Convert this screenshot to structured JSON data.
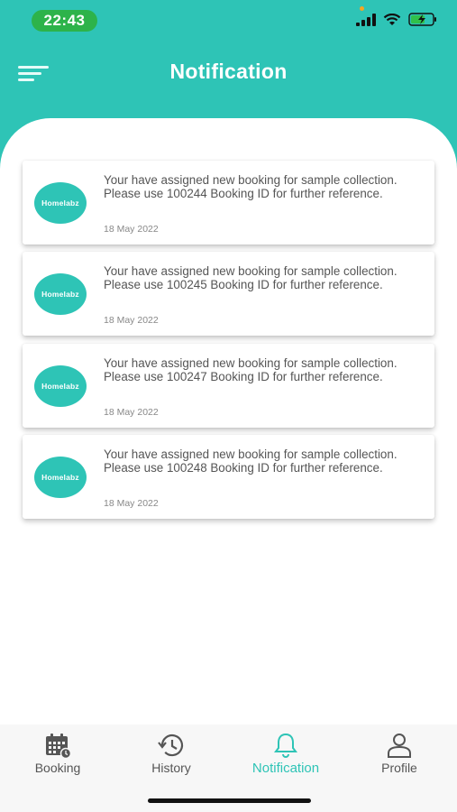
{
  "status_bar": {
    "time": "22:43"
  },
  "header": {
    "title": "Notification"
  },
  "notifications": [
    {
      "logo_text": "Homelabz",
      "message": "Your have assigned new booking for sample collection. Please use 100244 Booking ID for further reference.",
      "date": "18 May 2022"
    },
    {
      "logo_text": "Homelabz",
      "message": "Your have assigned new booking for sample collection. Please use 100245 Booking ID for further reference.",
      "date": "18 May 2022"
    },
    {
      "logo_text": "Homelabz",
      "message": "Your have assigned new booking for sample collection. Please use 100247 Booking ID for further reference.",
      "date": "18 May 2022"
    },
    {
      "logo_text": "Homelabz",
      "message": "Your have assigned new booking for sample collection. Please use 100248 Booking ID for further reference.",
      "date": "18 May 2022"
    }
  ],
  "tabs": [
    {
      "label": "Booking",
      "icon": "calendar-icon"
    },
    {
      "label": "History",
      "icon": "history-icon"
    },
    {
      "label": "Notification",
      "icon": "bell-icon",
      "active": true
    },
    {
      "label": "Profile",
      "icon": "person-icon"
    }
  ],
  "colors": {
    "brand": "#2ec4b6",
    "time_pill": "#2db34a"
  }
}
